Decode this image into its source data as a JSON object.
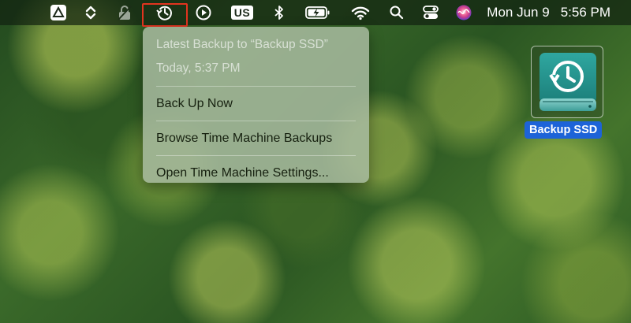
{
  "menubar": {
    "icons": [
      "drive-upload-icon",
      "chevron-updown-icon",
      "lock-slash-icon",
      "time-machine-icon",
      "play-circle-icon",
      "bluetooth-icon",
      "battery-charging-icon",
      "wifi-icon",
      "search-icon",
      "control-center-icon",
      "siri-icon"
    ],
    "input_source": "US",
    "date": "Mon Jun 9",
    "time": "5:56 PM",
    "highlight_color": "#e2341f"
  },
  "time_machine_menu": {
    "latest_backup_line1": "Latest Backup to “Backup SSD”",
    "latest_backup_line2": "Today, 5:37 PM",
    "back_up_now": "Back Up Now",
    "browse_backups": "Browse Time Machine Backups",
    "open_settings": "Open Time Machine Settings..."
  },
  "desktop": {
    "drive_icon": "time-machine-drive-icon",
    "drive_label": "Backup SSD",
    "selection_color": "#1d63d8"
  }
}
